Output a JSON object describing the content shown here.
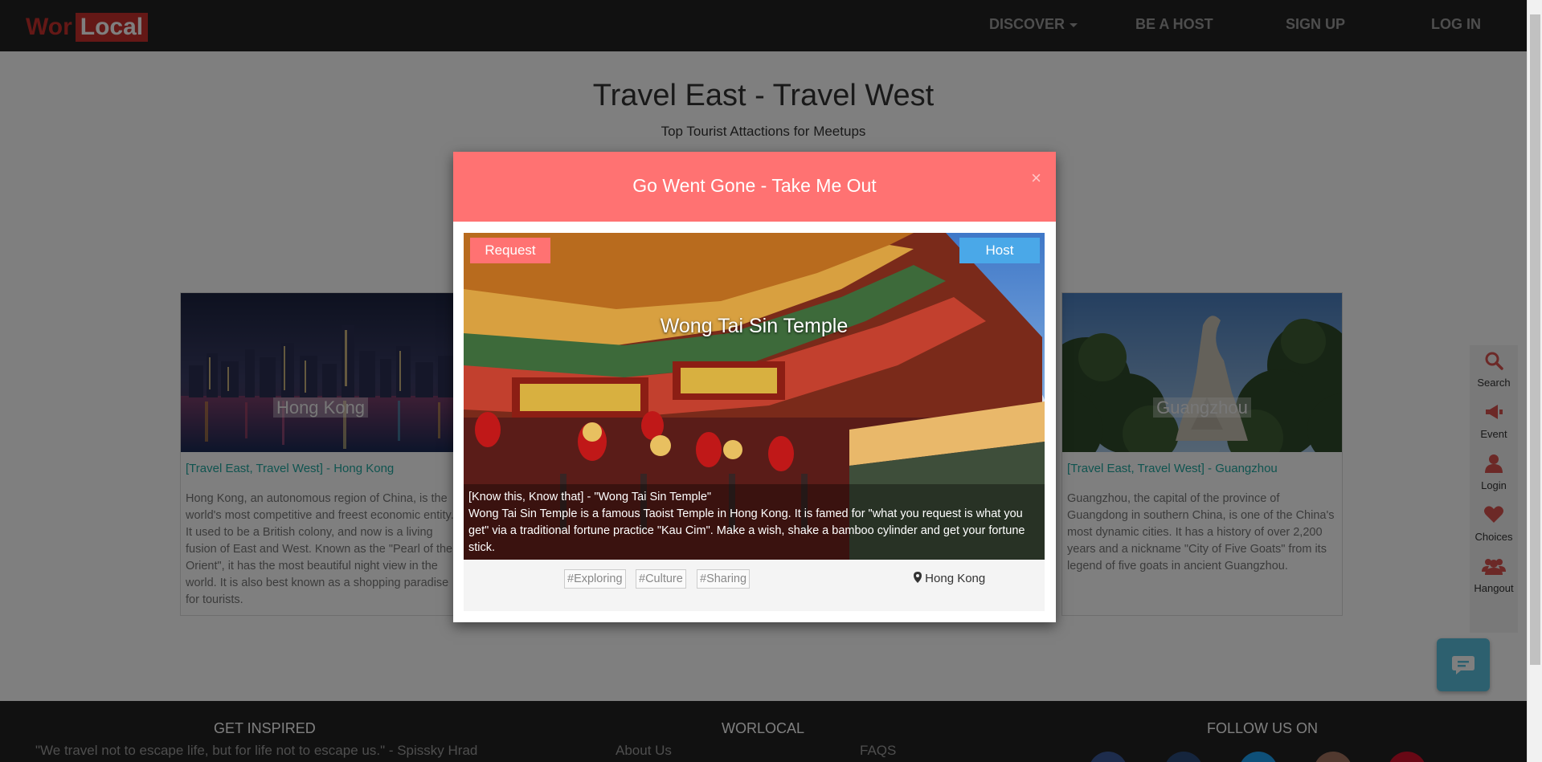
{
  "navbar": {
    "logo_part1": "Wor",
    "logo_part2": "Local",
    "discover": "DISCOVER",
    "be_a_host": "BE A HOST",
    "sign_up": "SIGN UP",
    "log_in": "LOG IN"
  },
  "hero": {
    "title": "Travel East - Travel West",
    "subtitle": "Top Tourist Attactions for Meetups"
  },
  "cards": [
    {
      "city": "Hong Kong",
      "link": "[Travel East, Travel West] - Hong Kong",
      "text": "Hong Kong, an autonomous region of China, is the world's most competitive and freest economic entity. It used to be a British colony, and now is a living fusion of East and West. Known as the \"Pearl of the Orient\", it has the most beautiful night view in the world. It is also best known as a shopping paradise for tourists."
    },
    {
      "city": "Guangzhou",
      "link": "[Travel East, Travel West] - Guangzhou",
      "text": "Guangzhou, the capital of the province of Guangdong in southern China, is one of the China's most dynamic cities. It has a history of over 2,200 years and a nickname \"City of Five Goats\" from its legend of five goats in ancient Guangzhou."
    }
  ],
  "modal": {
    "title": "Go Went Gone - Take Me Out",
    "close": "×",
    "request": "Request",
    "host": "Host",
    "image_title": "Wong Tai Sin Temple",
    "caption_head": "[Know this, Know that] - \"Wong Tai Sin Temple\"",
    "caption_body": "Wong Tai Sin Temple is a famous Taoist Temple in Hong Kong. It is famed for \"what you request is what you get\" via a traditional fortune practice \"Kau Cim\". Make a wish, shake a bamboo cylinder and get your fortune stick.",
    "tags": [
      "#Exploring",
      "#Culture",
      "#Sharing"
    ],
    "location": "Hong Kong"
  },
  "side_menu": [
    {
      "label": "Search",
      "icon": "search-icon"
    },
    {
      "label": "Event",
      "icon": "megaphone-icon"
    },
    {
      "label": "Login",
      "icon": "user-icon"
    },
    {
      "label": "Choices",
      "icon": "heart-icon"
    },
    {
      "label": "Hangout",
      "icon": "users-icon"
    }
  ],
  "footer": {
    "inspired_heading": "GET INSPIRED",
    "inspired_quote": "\"We travel not to escape life, but for life not to escape us.\" - Spissky Hrad",
    "worlocal_heading": "WORLOCAL",
    "about": "About Us",
    "faqs": "FAQS",
    "follow_heading": "FOLLOW US ON"
  },
  "colors": {
    "accent": "#ff7272",
    "brand_red": "#c9302c",
    "host_blue": "#4aa8e8",
    "link_teal": "#20a8a0",
    "navbar": "#222222"
  }
}
